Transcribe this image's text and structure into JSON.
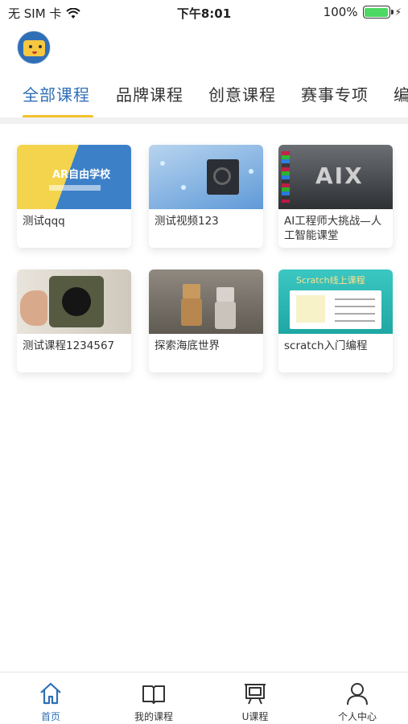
{
  "status_bar": {
    "carrier": "无 SIM 卡",
    "time": "下午8:01",
    "battery": "100%",
    "battery_level": 1.0
  },
  "header": {
    "avatar_icon": "avatar-icon"
  },
  "tabs": [
    {
      "label": "全部课程",
      "active": true
    },
    {
      "label": "品牌课程",
      "active": false
    },
    {
      "label": "创意课程",
      "active": false
    },
    {
      "label": "赛事专项",
      "active": false
    },
    {
      "label": "编",
      "active": false
    }
  ],
  "courses": [
    {
      "title": "测试qqq",
      "thumb_text": "AR自由学校"
    },
    {
      "title": "测试视频123"
    },
    {
      "title": "AI工程师大挑战—人工智能课堂",
      "thumb_text": "AIX"
    },
    {
      "title": "测试课程1234567"
    },
    {
      "title": "探索海底世界"
    },
    {
      "title": "scratch入门编程",
      "thumb_text": "Scratch线上课程"
    }
  ],
  "bottom_nav": [
    {
      "label": "首页",
      "icon": "home-icon",
      "active": true
    },
    {
      "label": "我的课程",
      "icon": "book-icon",
      "active": false
    },
    {
      "label": "U课程",
      "icon": "presentation-board-icon",
      "active": false
    },
    {
      "label": "个人中心",
      "icon": "person-icon",
      "active": false
    }
  ],
  "colors": {
    "accent": "#2f6fb6",
    "tab_underline": "#f3c12f",
    "battery": "#4cd964"
  }
}
